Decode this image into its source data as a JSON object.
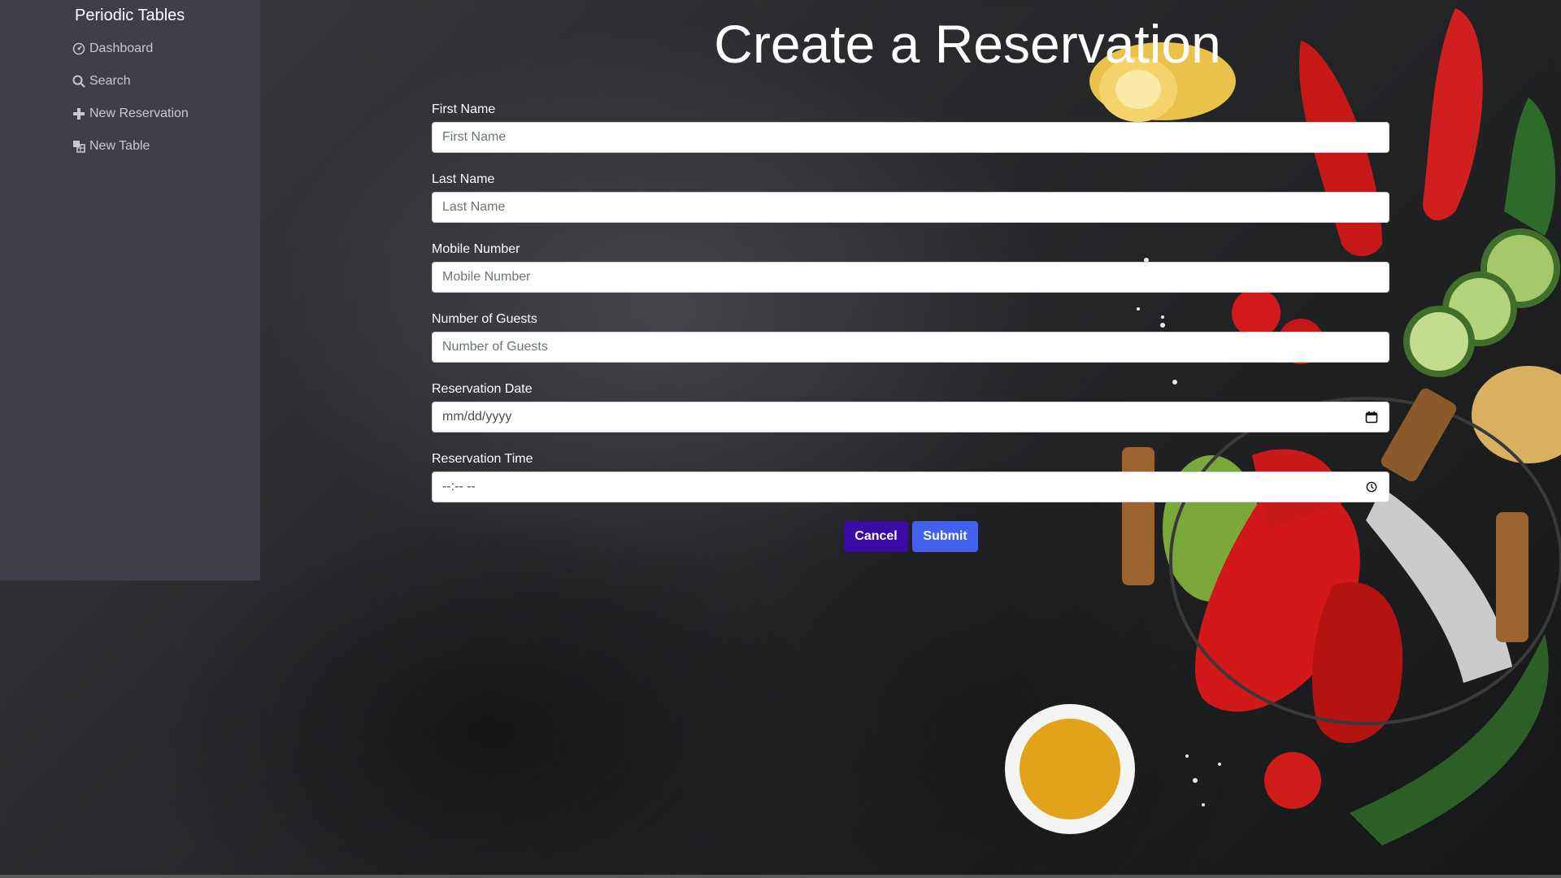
{
  "sidebar": {
    "brand": "Periodic Tables",
    "items": [
      {
        "label": "Dashboard",
        "icon": "dashboard-icon"
      },
      {
        "label": "Search",
        "icon": "search-icon"
      },
      {
        "label": "New Reservation",
        "icon": "plus-icon"
      },
      {
        "label": "New Table",
        "icon": "table-icon"
      }
    ]
  },
  "page": {
    "title": "Create a Reservation"
  },
  "form": {
    "first_name": {
      "label": "First Name",
      "placeholder": "First Name"
    },
    "last_name": {
      "label": "Last Name",
      "placeholder": "Last Name"
    },
    "mobile_number": {
      "label": "Mobile Number",
      "placeholder": "Mobile Number"
    },
    "people": {
      "label": "Number of Guests",
      "placeholder": "Number of Guests"
    },
    "reservation_date": {
      "label": "Reservation Date",
      "value": "mm/dd/yyyy",
      "icon": "calendar-icon"
    },
    "reservation_time": {
      "label": "Reservation Time",
      "value": "--:-- --",
      "icon": "clock-icon"
    }
  },
  "buttons": {
    "cancel": "Cancel",
    "submit": "Submit"
  },
  "colors": {
    "sidebar_bg": "#3f3f4a",
    "cancel_bg": "#3a0ca3",
    "submit_bg": "#4361ee"
  }
}
